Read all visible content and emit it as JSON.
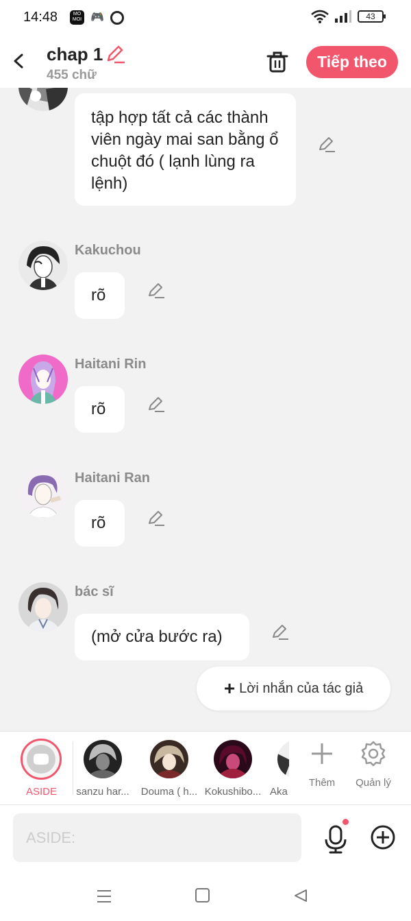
{
  "status": {
    "time": "14:48",
    "app_badge": "MO MOI",
    "battery": "43"
  },
  "header": {
    "title": "chap 1",
    "word_count": "455 chữ",
    "next_label": "Tiếp theo"
  },
  "messages": [
    {
      "speaker": "",
      "text": "tập hợp tất cả các thành viên ngày mai san bằng ổ chuột đó ( lạnh lùng ra lệnh)"
    },
    {
      "speaker": "Kakuchou",
      "text": "rõ"
    },
    {
      "speaker": "Haitani Rin",
      "text": "rõ"
    },
    {
      "speaker": "Haitani Ran",
      "text": "rõ"
    },
    {
      "speaker": "bác sĩ",
      "text": "(mở cửa bước ra)"
    }
  ],
  "author_note": {
    "label": "Lời nhắn của tác giả"
  },
  "characters": {
    "aside_label": "ASIDE",
    "items": [
      {
        "name": "sanzu har..."
      },
      {
        "name": "Douma ( h..."
      },
      {
        "name": "Kokushibo..."
      },
      {
        "name": "Aka"
      }
    ],
    "add_label": "Thêm",
    "manage_label": "Quản lý"
  },
  "input": {
    "placeholder": "ASIDE:"
  },
  "colors": {
    "accent": "#f2566d",
    "background": "#f2f2f2"
  }
}
